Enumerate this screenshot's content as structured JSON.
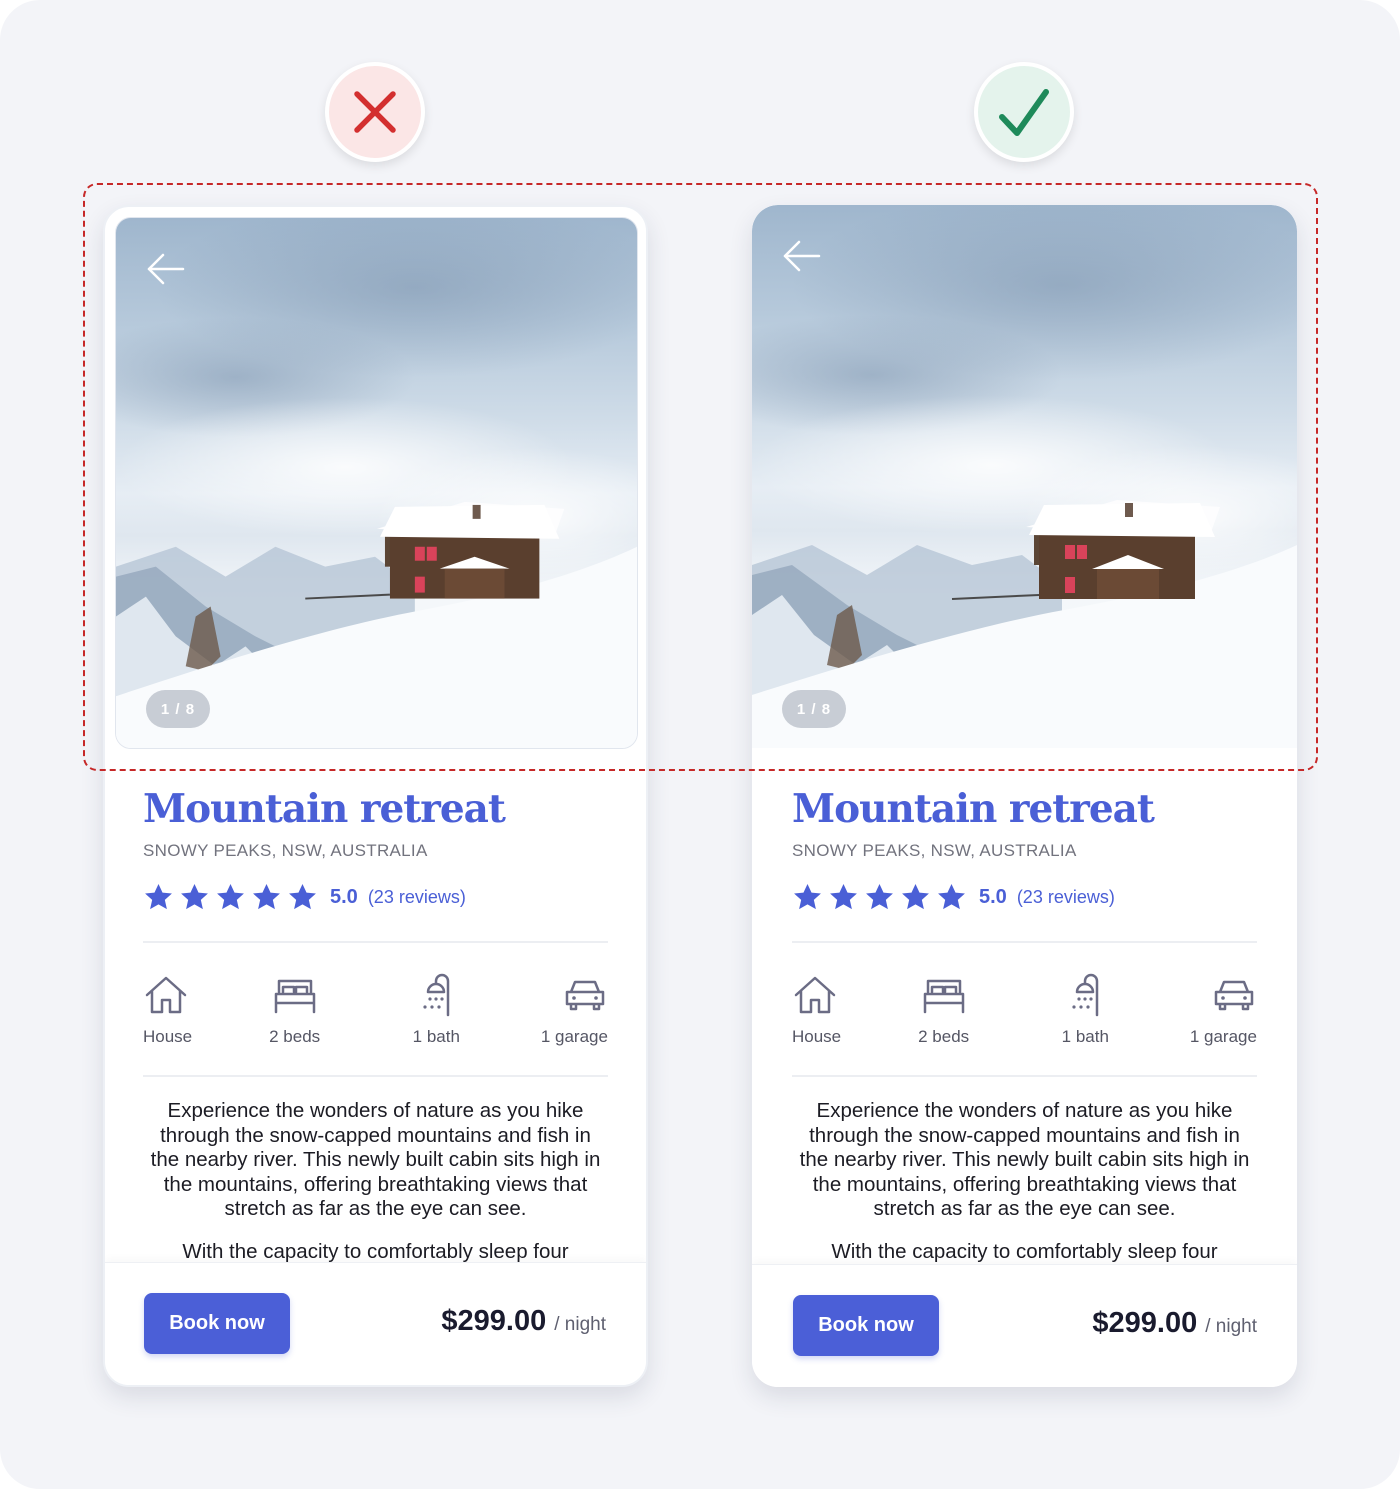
{
  "verdicts": {
    "left": {
      "icon": "cross-icon",
      "meaning": "incorrect",
      "color": "#d32f2f"
    },
    "right": {
      "icon": "check-icon",
      "meaning": "correct",
      "color": "#1e8a5a"
    }
  },
  "annotation": {
    "style": "dashed-outline",
    "color": "#c62828"
  },
  "cards": [
    {
      "variant": "left",
      "image_counter": "1 / 8",
      "title": "Mountain retreat",
      "location": "SNOWY PEAKS, NSW, AUSTRALIA",
      "rating": {
        "stars": 5,
        "max": 5,
        "value": "5.0",
        "reviews": "(23 reviews)"
      },
      "features": [
        {
          "icon": "house-icon",
          "label": "House"
        },
        {
          "icon": "bed-icon",
          "label": "2 beds"
        },
        {
          "icon": "shower-icon",
          "label": "1 bath"
        },
        {
          "icon": "car-icon",
          "label": "1 garage"
        }
      ],
      "description": [
        "Experience the wonders of nature as you hike through the snow-capped mountains and fish in the nearby river. This newly built cabin sits high in the mountains, offering breathtaking views that stretch as far as the eye can see.",
        "With the capacity to comfortably sleep four"
      ],
      "book_label": "Book now",
      "price": "$299.00",
      "price_unit": "/ night"
    },
    {
      "variant": "right",
      "image_counter": "1 / 8",
      "title": "Mountain retreat",
      "location": "SNOWY PEAKS, NSW, AUSTRALIA",
      "rating": {
        "stars": 5,
        "max": 5,
        "value": "5.0",
        "reviews": "(23 reviews)"
      },
      "features": [
        {
          "icon": "house-icon",
          "label": "House"
        },
        {
          "icon": "bed-icon",
          "label": "2 beds"
        },
        {
          "icon": "shower-icon",
          "label": "1 bath"
        },
        {
          "icon": "car-icon",
          "label": "1 garage"
        }
      ],
      "description": [
        "Experience the wonders of nature as you hike through the snow-capped mountains and fish in the nearby river. This newly built cabin sits high in the mountains, offering breathtaking views that stretch as far as the eye can see.",
        "With the capacity to comfortably sleep four"
      ],
      "book_label": "Book now",
      "price": "$299.00",
      "price_unit": "/ night"
    }
  ],
  "colors": {
    "accent": "#4b5fd7",
    "title": "#4a5fd6",
    "icon_stroke": "#6b6c85",
    "price": "#1a1b2e"
  }
}
